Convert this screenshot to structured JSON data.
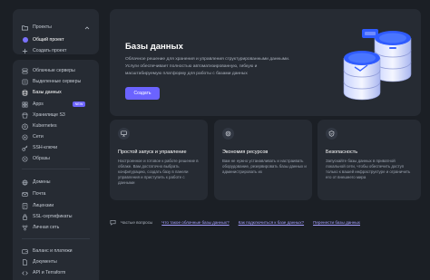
{
  "sidebar": {
    "projects": {
      "header": "Проекты",
      "items": [
        {
          "label": "Общий проект"
        },
        {
          "label": "Создать проект"
        }
      ]
    },
    "nav": [
      {
        "label": "Облачные серверы",
        "icon": "server-icon"
      },
      {
        "label": "Выделенные серверы",
        "icon": "dedicated-server-icon"
      },
      {
        "label": "Базы данных",
        "icon": "database-icon",
        "active": true
      },
      {
        "label": "Apps",
        "icon": "apps-icon",
        "badge": "NEW"
      },
      {
        "label": "Хранилище S3",
        "icon": "storage-icon"
      },
      {
        "label": "Kubernetes",
        "icon": "kubernetes-icon"
      },
      {
        "label": "Сети",
        "icon": "network-icon"
      },
      {
        "label": "SSH-ключи",
        "icon": "key-icon"
      },
      {
        "label": "Образы",
        "icon": "image-icon"
      },
      {
        "label": "Домены",
        "icon": "globe-icon"
      },
      {
        "label": "Почта",
        "icon": "mail-icon"
      },
      {
        "label": "Лицензии",
        "icon": "license-icon"
      },
      {
        "label": "SSL-сертификаты",
        "icon": "certificate-icon"
      },
      {
        "label": "Личная сеть",
        "icon": "private-network-icon"
      },
      {
        "label": "Баланс и платежи",
        "icon": "wallet-icon"
      },
      {
        "label": "Документы",
        "icon": "documents-icon"
      },
      {
        "label": "API и Terraform",
        "icon": "api-icon"
      }
    ]
  },
  "hero": {
    "title": "Базы данных",
    "lines": [
      "Облачное решение для хранения и управления структурированными данными.",
      "Услуги обеспечивает полностью автоматизированную, гибкую и",
      "масштабируемую платформу для работы с базами данных"
    ],
    "button_label": "Создать"
  },
  "cards": [
    {
      "icon": "monitor-icon",
      "title": "Простой запуск и управление",
      "desc": "Настроенное и готовое к работе решение в облаке. Вам достаточно выбрать конфигурацию, создать базу в панели управления и приступить к работе с данными"
    },
    {
      "icon": "savings-icon",
      "title": "Экономия ресурсов",
      "desc": "Вам не нужно устанавливать и настраивать оборудование, резервировать базы данных и администрировать их"
    },
    {
      "icon": "shield-icon",
      "title": "Безопасность",
      "desc": "Запускайте базы данных в приватной локальной сети, чтобы обеспечить доступ только к вашей инфраструктуре и ограничить его от внешнего мира"
    }
  ],
  "faq": {
    "label": "Частые вопросы",
    "links": [
      "Что такое облачные базы данных?",
      "Как подключиться к базе данных?",
      "Перенести базы данных"
    ]
  },
  "colors": {
    "accent": "#6b63ff",
    "background": "#1b1f25",
    "panel": "#262b33"
  }
}
